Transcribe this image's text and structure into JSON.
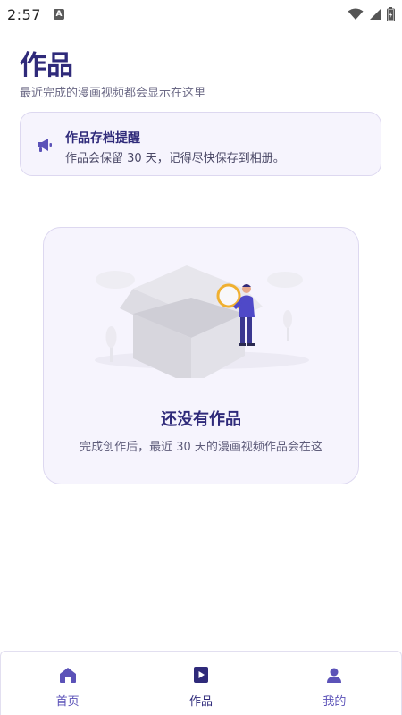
{
  "status_bar": {
    "time": "2:57",
    "app_indicator": "A",
    "icons": [
      "wifi-icon",
      "signal-icon",
      "battery-icon"
    ]
  },
  "header": {
    "title": "作品",
    "subtitle": "最近完成的漫画视频都会显示在这里"
  },
  "notice": {
    "icon": "megaphone-icon",
    "title": "作品存档提醒",
    "text": "作品会保留 30 天，记得尽快保存到相册。"
  },
  "empty_state": {
    "illustration": "empty-box-with-magnifier-illustration",
    "title": "还没有作品",
    "description": "完成创作后，最近 30 天的漫画视频作品会在这"
  },
  "bottom_nav": {
    "items": [
      {
        "label": "首页",
        "icon": "home-icon",
        "active": false
      },
      {
        "label": "作品",
        "icon": "play-icon",
        "active": true
      },
      {
        "label": "我的",
        "icon": "person-icon",
        "active": false
      }
    ]
  },
  "colors": {
    "primary": "#2f2a7a",
    "accent": "#5b52b8",
    "card_bg": "#f6f4fd",
    "card_border": "#ddd8f0"
  }
}
